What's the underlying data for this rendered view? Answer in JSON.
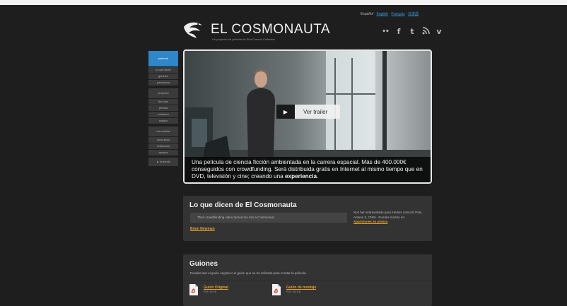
{
  "header": {
    "language": {
      "current": "Español",
      "separator": " · ",
      "links": [
        "English",
        "Français",
        "日本語"
      ]
    },
    "title": "EL COSMONAUTA",
    "subtitle": "Un proyecto de película de Riot Cinema Collective",
    "social_icons": [
      "flickr-icon",
      "facebook-icon",
      "tumblr-icon",
      "rss-icon",
      "vimeo-icon"
    ],
    "social_glyphs": [
      "••",
      "f",
      "t",
      "⁞",
      "v"
    ]
  },
  "sidenav": {
    "items": [
      {
        "label": "película",
        "active": true
      },
      {
        "label": "lo que dicen"
      },
      {
        "label": "guiones"
      },
      {
        "label": "panorama"
      },
      {
        "label": "proyecto",
        "group": true
      },
      {
        "label": "the plan"
      },
      {
        "label": "prensa"
      },
      {
        "label": "colabora"
      },
      {
        "label": "equipo"
      },
      {
        "label": "comunidad",
        "group": true
      },
      {
        "label": "concursos"
      },
      {
        "label": "enlázanos"
      },
      {
        "label": "apoyos"
      },
      {
        "label": "la tienda",
        "shop": true
      }
    ]
  },
  "hero": {
    "trailer_label": "Ver trailer",
    "caption_text": "Una película de ciencia ficción ambientada en la carrera espacial. Más de 400.000€ conseguidos con crowdfunding. Será distribuida gratis en Internet al mismo tiempo que en DVD, televisión y cine; creando una ",
    "caption_bold": "experiencia",
    "caption_end": "."
  },
  "lo_que_dicen": {
    "title": "Lo que dicen de El Cosmonauta",
    "quote": "Their crowdfunding video turned me into a Cosmonaut.",
    "author": "Brian Newman",
    "press_text": "Nos han entrevistado para medios como El País, Antena 3, CNN+. Puedes mirarlo en:",
    "press_link": "Apariciones en prensa"
  },
  "guiones": {
    "title": "Guiones",
    "description": "Puedes leer el guión original o el guión que se ha utilizado para montar la película.",
    "docs": [
      {
        "name": "Guión Original",
        "size": "PDF, 99 KB"
      },
      {
        "name": "Guión de montaje",
        "size": "PDF, 152 KB"
      }
    ]
  },
  "colors": {
    "background": "#1e1e1e",
    "accent_blue": "#2f86c9",
    "link_orange": "#e0a030",
    "panel": "#333333"
  }
}
